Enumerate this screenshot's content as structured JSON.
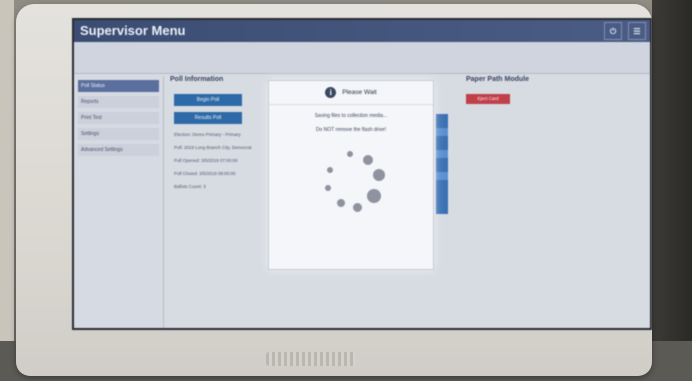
{
  "screen": {
    "title": "Supervisor Menu",
    "header_icons": [
      "power-icon",
      "menu-icon"
    ]
  },
  "modal": {
    "title": "Please Wait",
    "line1": "Saving files to collection media...",
    "line2": "Do NOT remove the flash drive!"
  },
  "sidebar": {
    "items": [
      {
        "label": "Poll Status",
        "active": true
      },
      {
        "label": "Reports",
        "active": false
      },
      {
        "label": "Print Test",
        "active": false
      },
      {
        "label": "Settings",
        "active": false
      },
      {
        "label": "Advanced Settings",
        "active": false
      }
    ]
  },
  "poll_panel": {
    "title": "Poll Information",
    "open_button": "Begin Poll",
    "results_button": "Results Poll",
    "lines": [
      "Election: Demo Primary - Primary",
      "Poll: 2019 Long Branch City, Democrat",
      "Poll Opened: 3/5/2019 07:00:00",
      "Poll Closed: 3/5/2019 08:00:00",
      "Ballots Count: 3"
    ]
  },
  "paper_panel": {
    "title": "Paper Path Module",
    "button": "Eject Card"
  },
  "colors": {
    "topbar": "#3c4d73",
    "modal_bg": "#f4f6f9",
    "accent_blue": "#2f6aa8",
    "accent_red": "#c0404a"
  }
}
